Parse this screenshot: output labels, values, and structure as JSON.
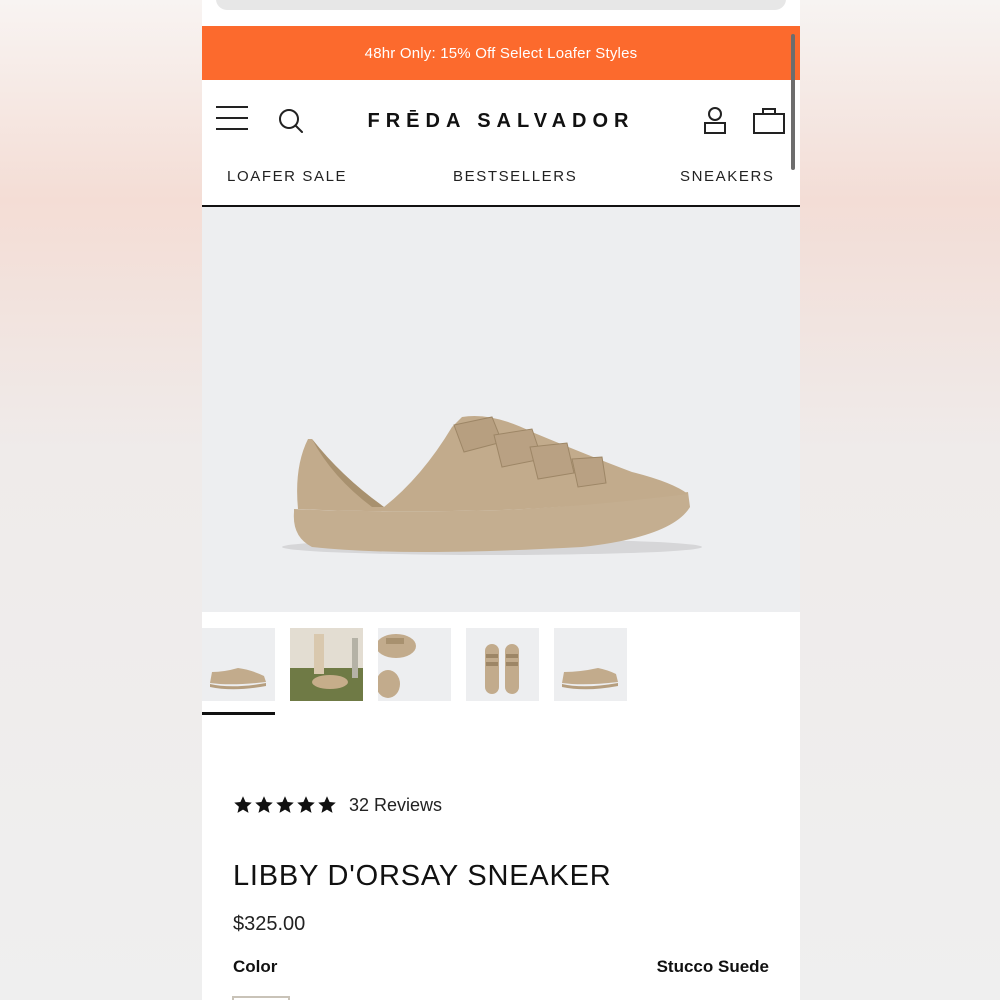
{
  "promo": {
    "text": "48hr Only: 15% Off Select Loafer Styles",
    "bg_color": "#fc6a2d"
  },
  "header": {
    "logo": "FRĒDA SALVADOR",
    "icons": [
      "menu-icon",
      "search-icon",
      "account-icon",
      "bag-icon"
    ]
  },
  "nav": {
    "items": [
      {
        "label": "LOAFER SALE"
      },
      {
        "label": "BESTSELLERS"
      },
      {
        "label": "SNEAKERS"
      }
    ]
  },
  "gallery": {
    "thumbnail_count": 5,
    "selected_index": 0
  },
  "product": {
    "rating": 5,
    "reviews": "32 Reviews",
    "title": "LIBBY D'ORSAY SNEAKER",
    "price": "$325.00",
    "color_label": "Color",
    "color_value": "Stucco Suede"
  }
}
